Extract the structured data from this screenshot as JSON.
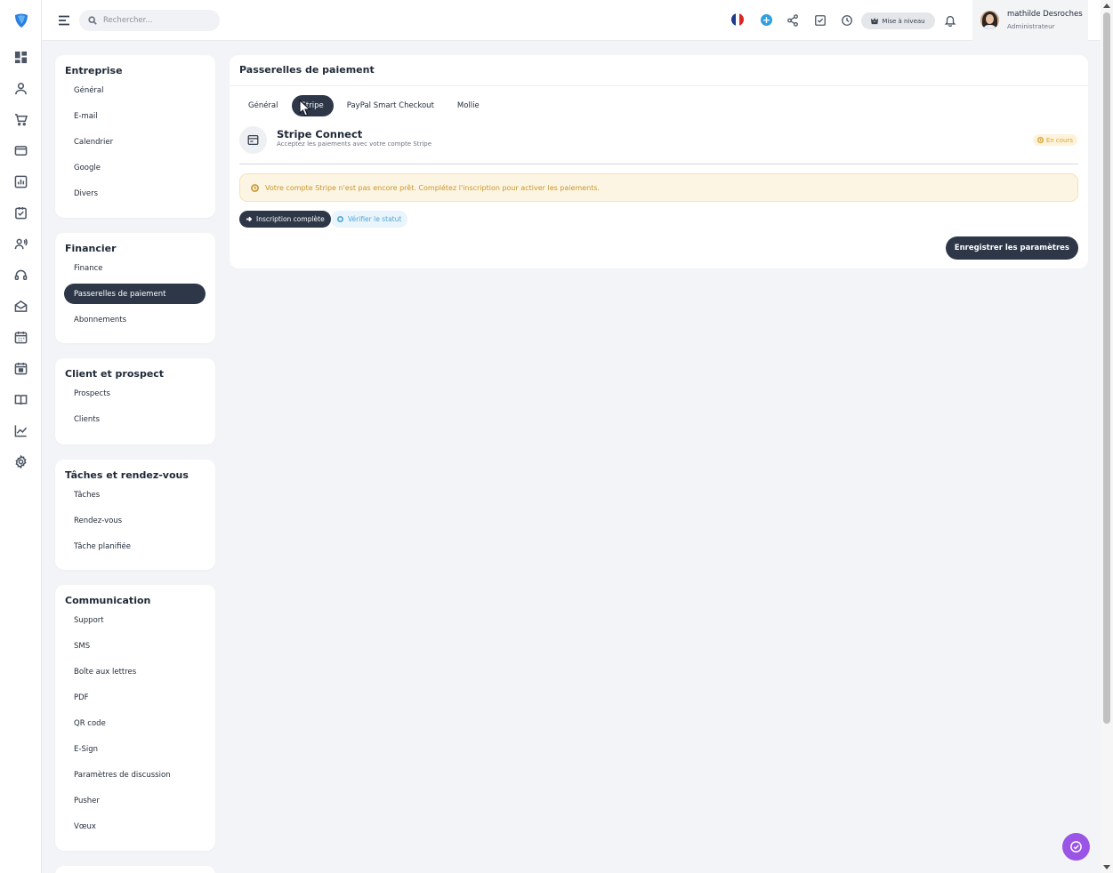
{
  "header": {
    "search_placeholder": "Rechercher...",
    "upgrade_label": "Mise à niveau",
    "user_name": "mathilde Desroches",
    "user_role": "Administrateur"
  },
  "settings_nav": {
    "entreprise": {
      "title": "Entreprise",
      "items": [
        "Général",
        "E-mail",
        "Calendrier",
        "Google",
        "Divers"
      ]
    },
    "financier": {
      "title": "Financier",
      "items": [
        "Finance",
        "Passerelles de paiement",
        "Abonnements"
      ],
      "active_index": 1
    },
    "client": {
      "title": "Client et prospect",
      "items": [
        "Prospects",
        "Clients"
      ]
    },
    "taches": {
      "title": "Tâches et rendez-vous",
      "items": [
        "Tâches",
        "Rendez-vous",
        "Tâche planifiée"
      ]
    },
    "communication": {
      "title": "Communication",
      "items": [
        "Support",
        "SMS",
        "Boîte aux lettres",
        "PDF",
        "QR code",
        "E-Sign",
        "Paramètres de discussion",
        "Pusher",
        "Vœux"
      ]
    }
  },
  "main": {
    "title": "Passerelles de paiement",
    "tabs": [
      "Général",
      "Stripe",
      "PayPal Smart Checkout",
      "Mollie"
    ],
    "active_tab": 1,
    "gateway": {
      "title": "Stripe Connect",
      "subtitle": "Acceptez les paiements avec votre compte Stripe",
      "status": "En cours"
    },
    "alert": "Votre compte Stripe n'est pas encore prêt. Complétez l'inscription pour activer les paiements.",
    "complete_label": "Inscription complète",
    "verify_label": "Vérifier le statut",
    "save_label": "Enregistrer les paramètres"
  },
  "colors": {
    "accent_dark": "#2d3748",
    "warning": "#d9a531",
    "info": "#55a7d8",
    "brand": "#2e7de0",
    "chat": "#9a55e6"
  }
}
